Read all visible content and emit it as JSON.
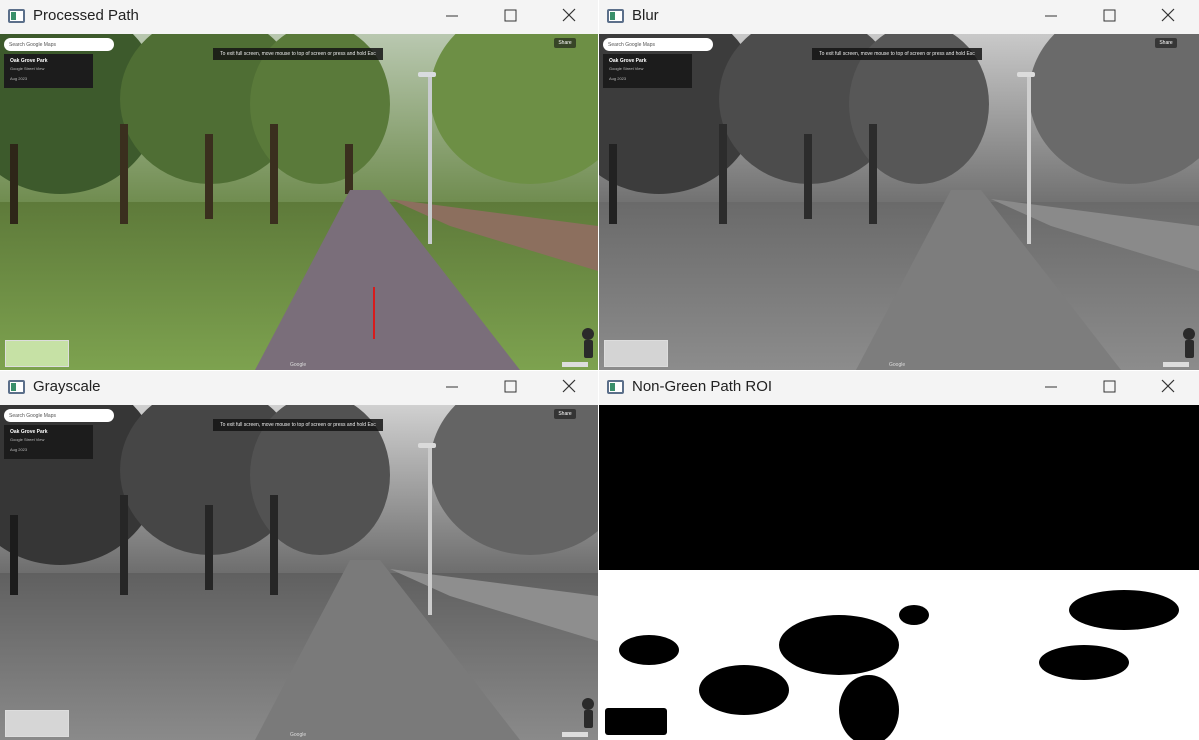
{
  "windows": [
    {
      "title": "Processed Path",
      "variant": "color"
    },
    {
      "title": "Blur",
      "variant": "gray"
    },
    {
      "title": "Grayscale",
      "variant": "gray"
    },
    {
      "title": "Non-Green Path ROI",
      "variant": "binary"
    }
  ],
  "street_view": {
    "search_placeholder": "Search Google Maps",
    "place_name": "Oak Grove Park",
    "place_sub": "Google Street View",
    "date": "Aug 2023",
    "banner": "To exit full screen, move mouse to top of screen or press and hold  Esc",
    "share": "Share",
    "attribution": "Google"
  },
  "colors": {
    "title_bar": "#f4f4f4",
    "path_marker": "#d81c1c"
  },
  "icons": [
    "window-app-icon",
    "minimize-icon",
    "maximize-icon",
    "close-icon",
    "search-icon",
    "directions-icon",
    "compass-icon",
    "zoom-icon"
  ]
}
